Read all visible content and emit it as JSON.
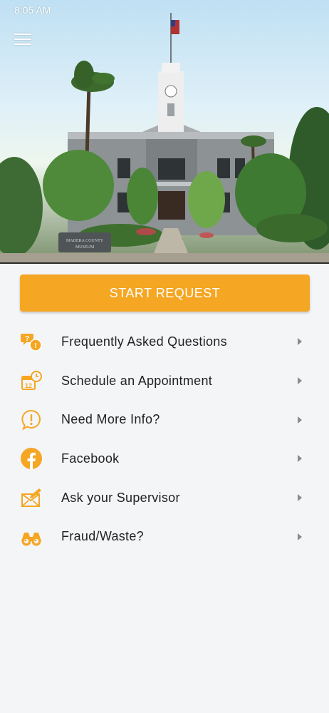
{
  "status_bar": {
    "time": "8:05 AM"
  },
  "hero": {
    "sign_line1": "MADERA COUNTY",
    "sign_line2": "MUSEUM"
  },
  "primary_action": {
    "label": "START REQUEST"
  },
  "colors": {
    "accent": "#f5a623",
    "background": "#f4f5f7",
    "text": "#222222",
    "chevron": "#8a8a8a"
  },
  "menu": [
    {
      "label": "Frequently Asked Questions",
      "icon": "faq-icon"
    },
    {
      "label": "Schedule an Appointment",
      "icon": "calendar-clock-icon"
    },
    {
      "label": "Need More Info?",
      "icon": "info-bubble-icon"
    },
    {
      "label": "Facebook",
      "icon": "facebook-icon"
    },
    {
      "label": "Ask your Supervisor",
      "icon": "mail-pencil-icon"
    },
    {
      "label": "Fraud/Waste?",
      "icon": "binoculars-icon"
    }
  ]
}
